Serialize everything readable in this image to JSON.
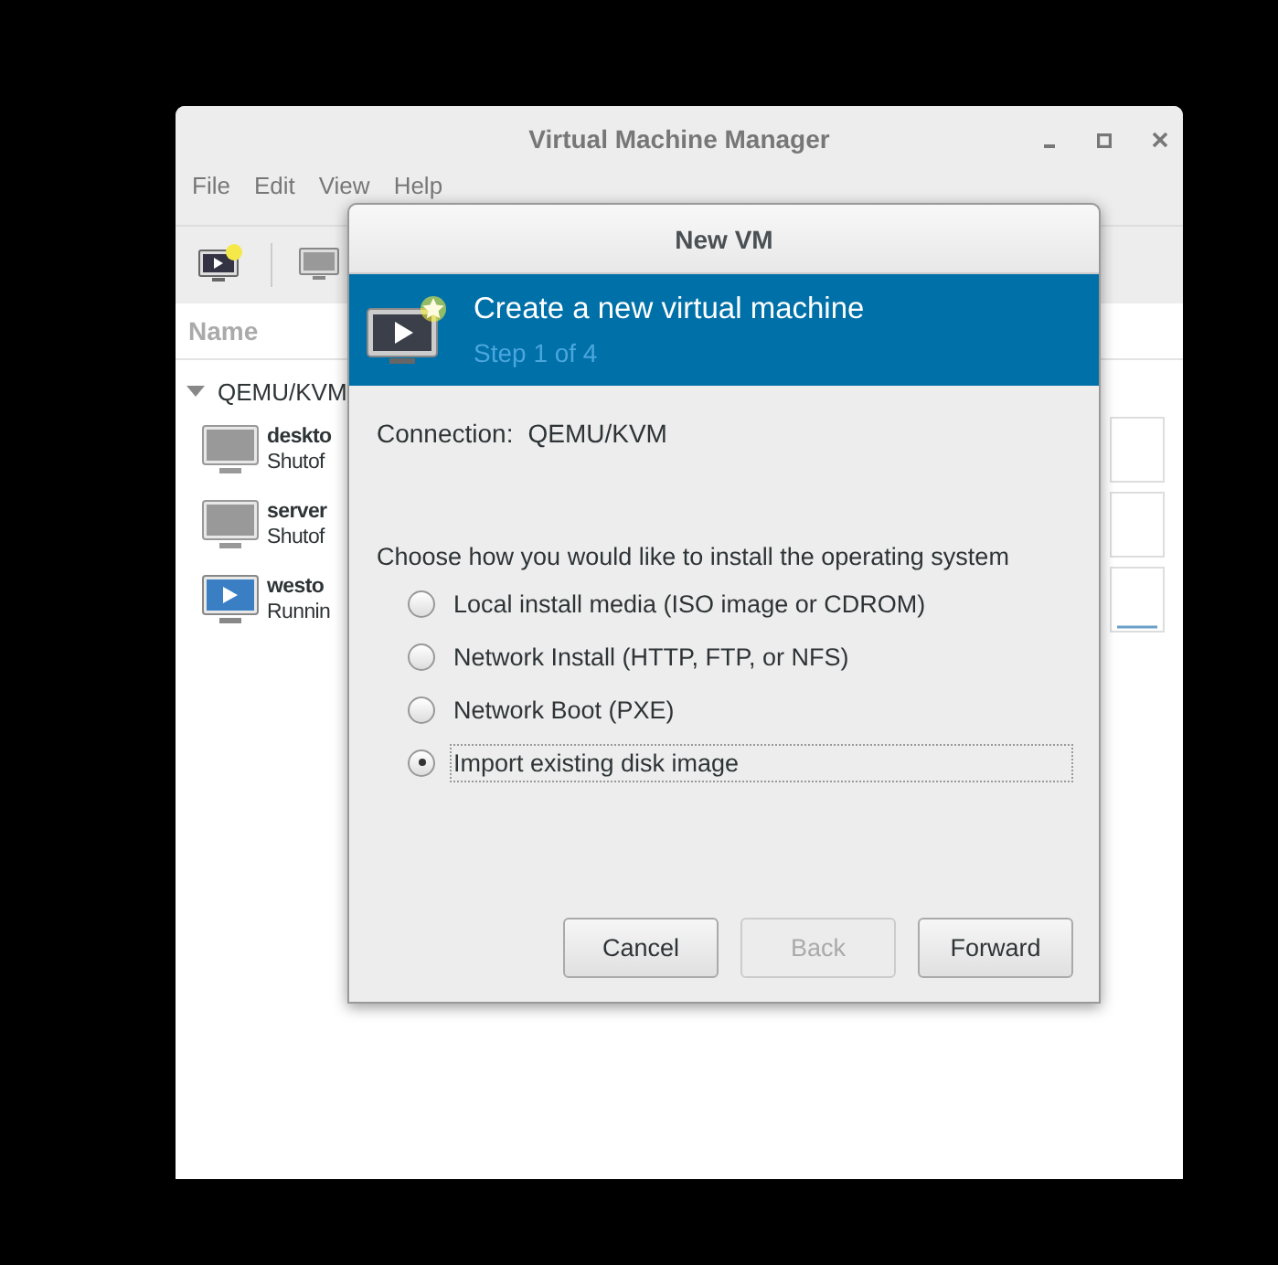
{
  "window": {
    "title": "Virtual Machine Manager"
  },
  "menu": [
    "File",
    "Edit",
    "View",
    "Help"
  ],
  "list": {
    "column": "Name",
    "groups": [
      {
        "name": "QEMU/KVM",
        "expanded": true,
        "vms": [
          {
            "name": "deskto",
            "status": "Shutof",
            "running": false
          },
          {
            "name": "server",
            "status": "Shutof",
            "running": false
          },
          {
            "name": "westo",
            "status": "Runnin",
            "running": true
          }
        ]
      }
    ]
  },
  "dialog": {
    "title": "New VM",
    "header": {
      "title": "Create a new virtual machine",
      "step": "Step 1 of 4"
    },
    "connection_label": "Connection:",
    "connection": "QEMU/KVM",
    "prompt": "Choose how you would like to install the operating system",
    "options": [
      {
        "label": "Local install media (ISO image or CDROM)",
        "selected": false
      },
      {
        "label": "Network Install (HTTP, FTP, or NFS)",
        "selected": false
      },
      {
        "label": "Network Boot (PXE)",
        "selected": false
      },
      {
        "label": "Import existing disk image",
        "selected": true
      }
    ],
    "buttons": [
      {
        "label": "Cancel",
        "disabled": false
      },
      {
        "label": "Back",
        "disabled": true
      },
      {
        "label": "Forward",
        "disabled": false
      }
    ]
  }
}
